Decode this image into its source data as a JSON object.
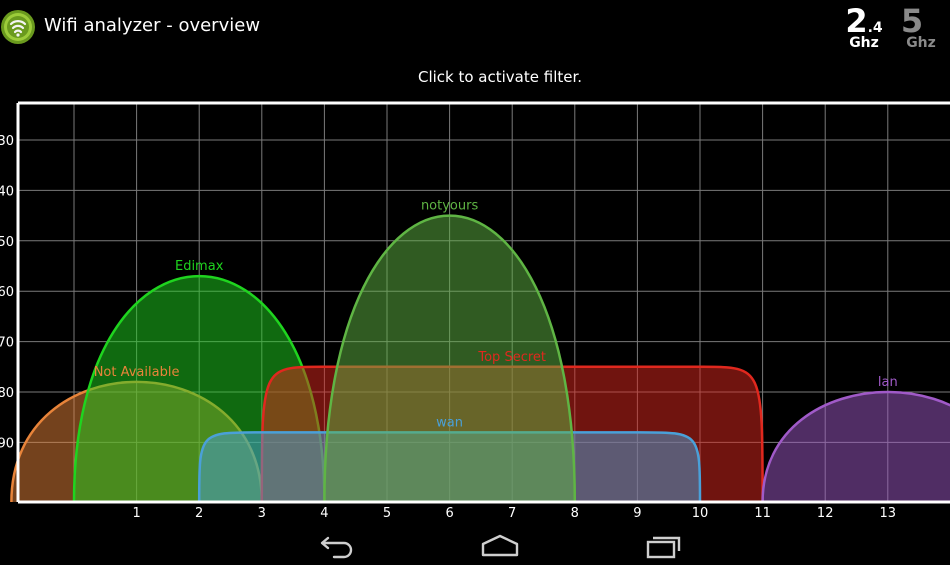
{
  "app": {
    "title": "Wifi analyzer - overview",
    "icon": "wifi-logo-icon"
  },
  "bands": {
    "band24": {
      "big": "2",
      "small": ".4",
      "unit": "Ghz",
      "active": true
    },
    "band5": {
      "big": "5",
      "small": "",
      "unit": "Ghz",
      "active": false
    }
  },
  "filter_hint": "Click to activate filter.",
  "chart_data": {
    "type": "area",
    "xlim": [
      -1,
      14
    ],
    "ylim": [
      -100,
      -20
    ],
    "x_ticks": [
      1,
      2,
      3,
      4,
      5,
      6,
      7,
      8,
      9,
      10,
      11,
      12,
      13
    ],
    "y_ticks": [
      30,
      40,
      50,
      60,
      70,
      80,
      90
    ],
    "grid": true,
    "series": [
      {
        "name": "Not Available",
        "channel_start": -1,
        "channel_end": 3,
        "center": 1,
        "signal": -78,
        "color": "#e8843a",
        "shape": "dome"
      },
      {
        "name": "Edimax",
        "channel_start": 0,
        "channel_end": 4,
        "center": 2,
        "signal": -57,
        "color": "#1fd41f",
        "shape": "dome"
      },
      {
        "name": "Top Secret",
        "channel_start": 3,
        "channel_end": 11,
        "center": 7,
        "signal": -75,
        "color": "#e0281e",
        "shape": "flat"
      },
      {
        "name": "wan",
        "channel_start": 2,
        "channel_end": 10,
        "center": 6,
        "signal": -88,
        "color": "#4aa0d8",
        "shape": "flat"
      },
      {
        "name": "notyours",
        "channel_start": 4,
        "channel_end": 8,
        "center": 6,
        "signal": -45,
        "color": "#5fb544",
        "shape": "dome"
      },
      {
        "name": "lan",
        "channel_start": 11,
        "channel_end": 15,
        "center": 13,
        "signal": -80,
        "color": "#a05ac8",
        "shape": "dome"
      }
    ]
  },
  "nav": {
    "back_icon": "back-arrow-icon",
    "home_icon": "home-icon",
    "recents_icon": "recent-apps-icon"
  }
}
